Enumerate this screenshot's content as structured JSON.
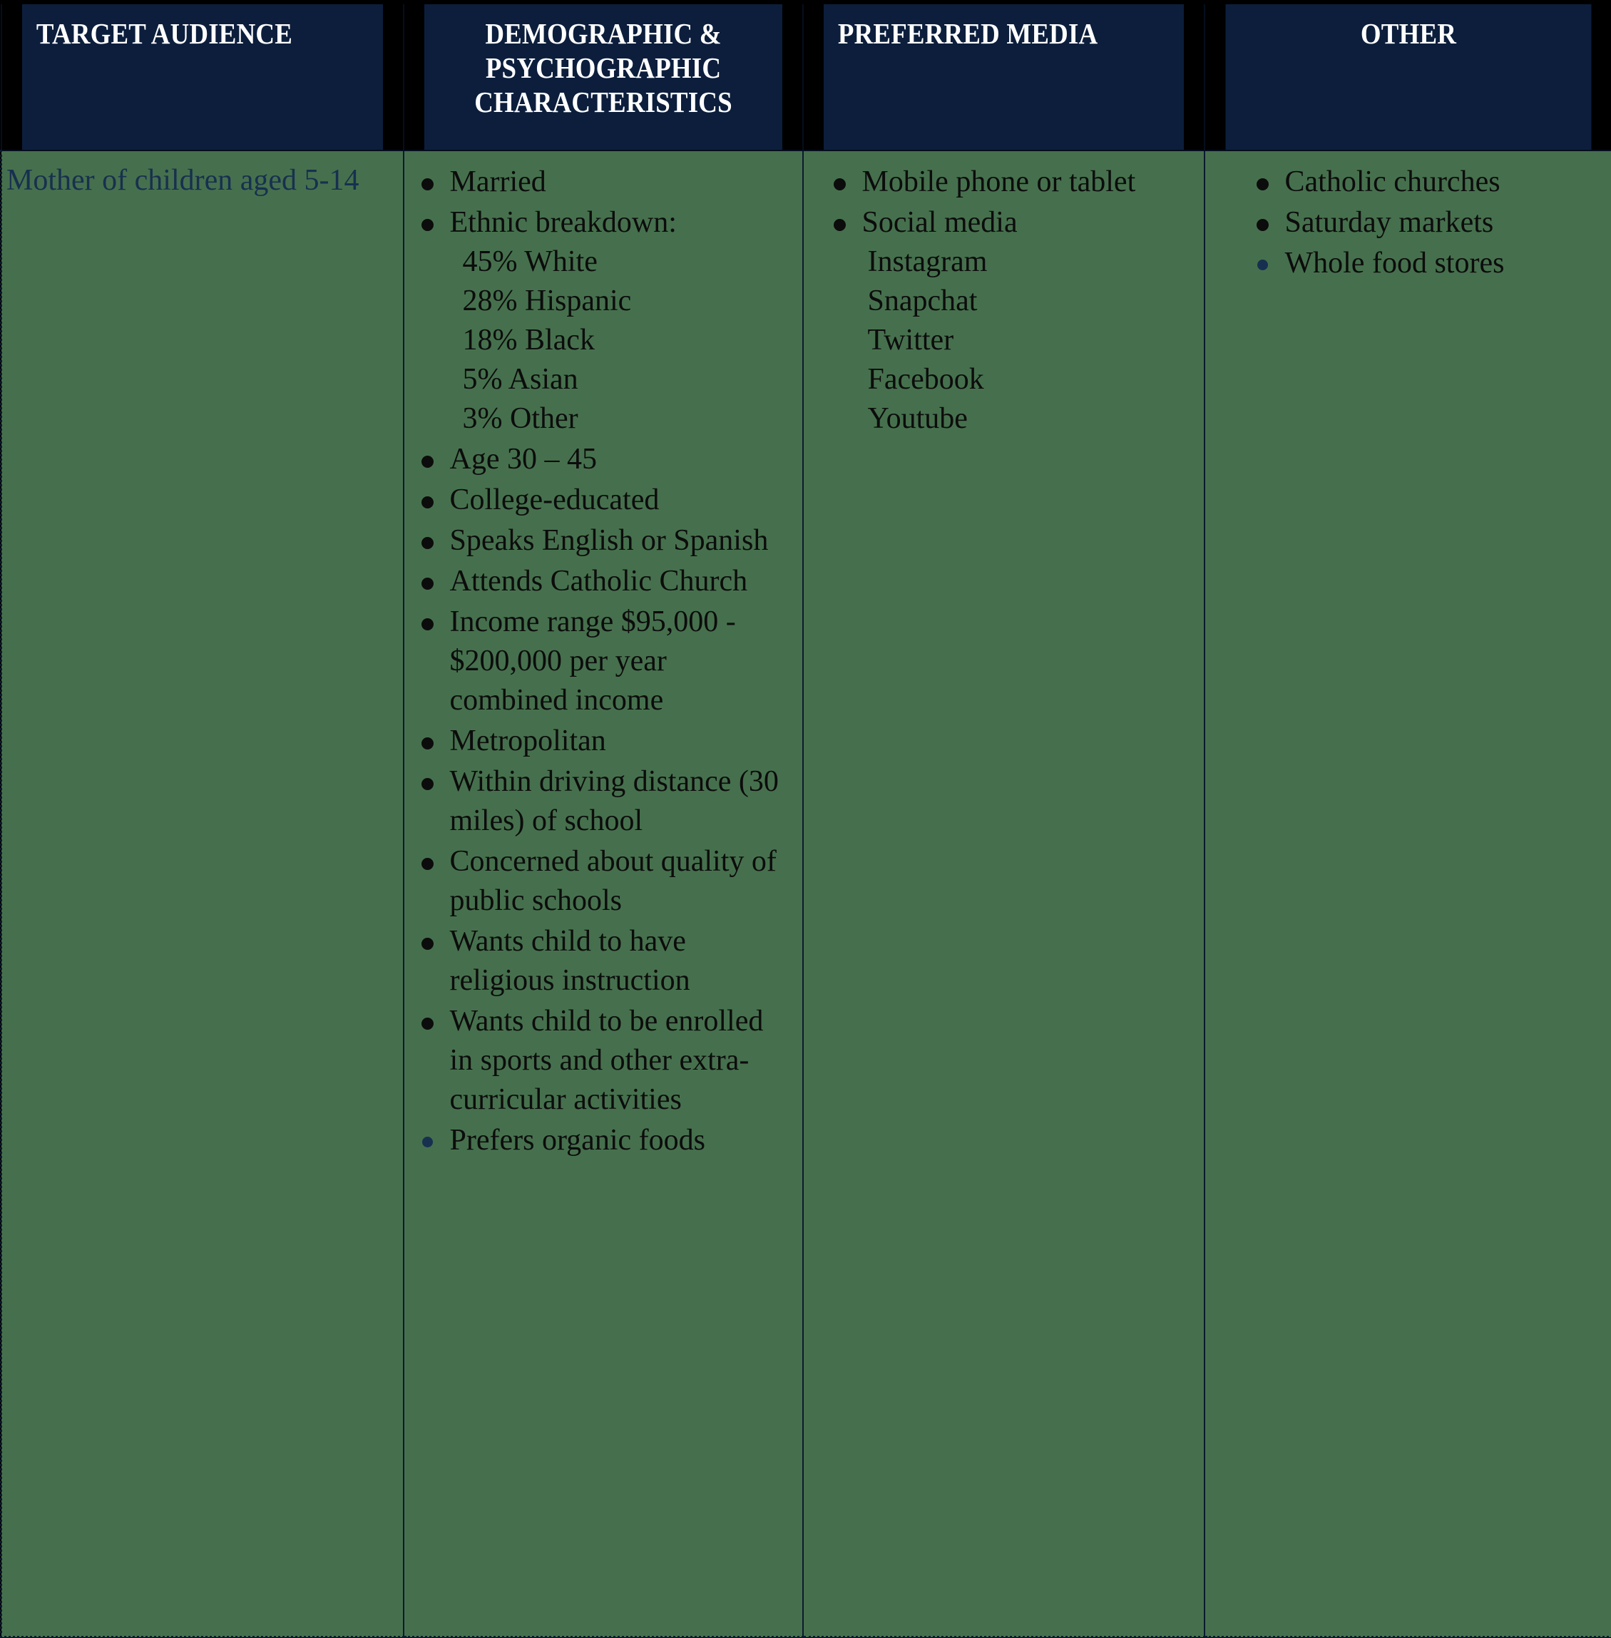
{
  "table": {
    "headers": [
      "TARGET AUDIENCE",
      "DEMOGRAPHIC & PSYCHOGRAPHIC CHARACTERISTICS",
      "PREFERRED MEDIA",
      "OTHER"
    ],
    "header_lines": {
      "demographic": [
        "DEMOGRAPHIC &",
        "PSYCHOGRAPHIC",
        "CHARACTERISTICS"
      ]
    },
    "colors": {
      "header_background": "#0C1E3C",
      "header_text": "#FFFFFF",
      "cell_background": "#46704D",
      "body_text": "#0C0C0C",
      "target_text": "#17304F",
      "border": "#0B1A30",
      "accent_bullet": "#17304F"
    },
    "row": {
      "target_audience": "Mother of children aged 5-14",
      "demographic": {
        "items": [
          "Married",
          "Ethnic breakdown:",
          "Age 30 – 45",
          "College-educated",
          "Speaks English or Spanish",
          "Attends Catholic Church",
          "Income range $95,000 - $200,000 per year combined income",
          "Metropolitan",
          "Within driving distance (30 miles) of school",
          "Concerned about quality of public schools",
          "Wants child to have religious instruction",
          "Wants child to be enrolled in sports and other extra-curricular activities",
          "Prefers organic foods"
        ],
        "ethnic_breakdown": [
          "45% White",
          "28% Hispanic",
          "18% Black",
          "5% Asian",
          "3% Other"
        ]
      },
      "preferred_media": {
        "items": [
          "Mobile phone or tablet",
          "Social media"
        ],
        "social_media_platforms": [
          "Instagram",
          "Snapchat",
          "Twitter",
          "Facebook",
          "Youtube"
        ]
      },
      "other": {
        "items": [
          "Catholic churches",
          "Saturday markets",
          "Whole food stores"
        ]
      }
    }
  }
}
